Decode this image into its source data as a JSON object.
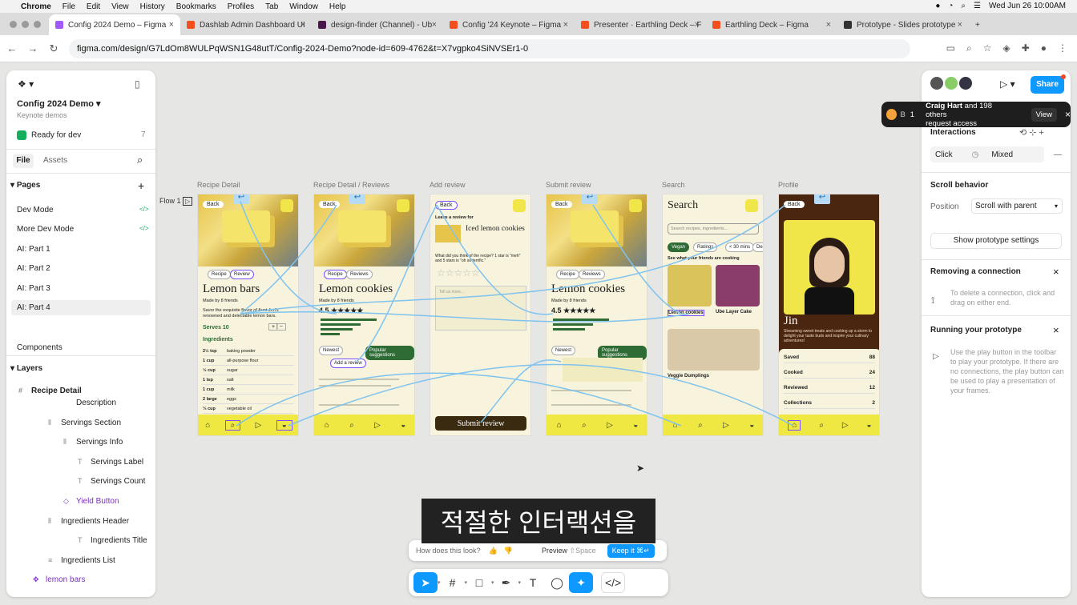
{
  "menubar": {
    "app": "Chrome",
    "items": [
      "File",
      "Edit",
      "View",
      "History",
      "Bookmarks",
      "Profiles",
      "Tab",
      "Window",
      "Help"
    ],
    "datetime": "Wed Jun 26  10:00AM"
  },
  "tabs": [
    {
      "label": "Config 2024 Demo – Figma",
      "active": true
    },
    {
      "label": "Dashlab Admin Dashboard UI",
      "active": false
    },
    {
      "label": "design-finder (Channel) - Ub",
      "active": false
    },
    {
      "label": "Config '24 Keynote – Figma",
      "active": false
    },
    {
      "label": "Presenter · Earthling Deck – F",
      "active": false
    },
    {
      "label": "Earthling Deck – Figma",
      "active": false
    },
    {
      "label": "Prototype - Slides prototype",
      "active": false
    }
  ],
  "address": {
    "url": "figma.com/design/G7LdOm8WULPqWSN1G48utT/Config-2024-Demo?node-id=609-4762&t=X7vgpko4SiNVSEr1-0"
  },
  "left_panel": {
    "file_title": "Config 2024 Demo",
    "subtitle": "Keynote demos",
    "ready_for_dev": "Ready for dev",
    "ready_count": "7",
    "tab_file": "File",
    "tab_assets": "Assets",
    "pages_label": "Pages",
    "pages": [
      {
        "label": "Dev Mode"
      },
      {
        "label": "More Dev Mode"
      },
      {
        "label": "AI: Part 1"
      },
      {
        "label": "AI: Part 2"
      },
      {
        "label": "AI: Part 3"
      },
      {
        "label": "AI: Part 4"
      }
    ],
    "components_label": "Components",
    "layers_label": "Layers",
    "layers": [
      {
        "label": "Recipe Detail"
      },
      {
        "label": "Description"
      },
      {
        "label": "Servings Section"
      },
      {
        "label": "Servings Info"
      },
      {
        "label": "Servings Label"
      },
      {
        "label": "Servings Count"
      },
      {
        "label": "Yield Button"
      },
      {
        "label": "Ingredients Header"
      },
      {
        "label": "Ingredients Title"
      },
      {
        "label": "Ingredients List"
      },
      {
        "label": "lemon bars"
      }
    ]
  },
  "right_panel": {
    "share": "Share",
    "toast_text_name": "Craig Hart",
    "toast_text_rest": " and 198 others",
    "toast_text_line2": "request access",
    "toast_view": "View",
    "toast_badge": "1",
    "interactions_label": "Interactions",
    "trigger": "Click",
    "mixed": "Mixed",
    "scroll_behavior": "Scroll behavior",
    "position_label": "Position",
    "position_value": "Scroll with parent",
    "show_settings": "Show prototype settings",
    "removing_title": "Removing a connection",
    "removing_text": "To delete a connection, click and drag on either end.",
    "running_title": "Running your prototype",
    "running_text": "Use the play button in the toolbar to play your prototype. If there are no connections, the play button can be used to play a presentation of your frames."
  },
  "canvas": {
    "flow_label": "Flow 1",
    "frames": [
      {
        "label": "Recipe Detail",
        "title": "Lemon bars"
      },
      {
        "label": "Recipe Detail / Reviews",
        "title": "Lemon cookies"
      },
      {
        "label": "Add review",
        "title": "Iced lemon cookies"
      },
      {
        "label": "Submit review",
        "title": "Lemon cookies"
      },
      {
        "label": "Search",
        "title": "Search"
      },
      {
        "label": "Profile",
        "title": "Jin"
      }
    ],
    "recipe": {
      "back": "Back",
      "tab_recipe": "Recipe",
      "tab_review": "Review",
      "tab_reviews": "Reviews",
      "made_by": "Made by 8 friends",
      "desc": "Savor the exquisite flavor of Aunt Jeri's renowned and delectable lemon bars.",
      "serves": "Serves 10",
      "ingredients_title": "Ingredients",
      "ingredients": [
        {
          "qty": "2½ tsp",
          "item": "baking powder"
        },
        {
          "qty": "1 cup",
          "item": "all-purpose flour"
        },
        {
          "qty": "½ cup",
          "item": "sugar"
        },
        {
          "qty": "1 tsp",
          "item": "salt"
        },
        {
          "qty": "1 cup",
          "item": "milk"
        },
        {
          "qty": "2 large",
          "item": "eggs"
        },
        {
          "qty": "⅓ cup",
          "item": "vegetable oil"
        }
      ]
    },
    "reviews": {
      "rating": "4.5",
      "newest": "Newest",
      "popular": "Popular suggestions",
      "add_review": "Add a review"
    },
    "add_review": {
      "leave": "Leave a review for",
      "question": "What did you think of the recipe? 1 star is \"meh\" and 5 stars is \"oh so terrific.\"",
      "placeholder": "Tell us more...",
      "submit": "Submit review"
    },
    "search": {
      "placeholder": "Search recipes, ingredients...",
      "chips": [
        "Vegan",
        "Ratings",
        "< 30 mins",
        "Des"
      ],
      "friends": "See what your friends are cooking",
      "item1": "Lemon cookies",
      "item2": "Ube Layer Cake",
      "item3": "Veggie Dumplings"
    },
    "profile": {
      "bio": "Streaming sweet treats and cooking up a storm to delight your taste buds and inspire your culinary adventures!",
      "rows": [
        {
          "label": "Saved",
          "count": "88"
        },
        {
          "label": "Cooked",
          "count": "24"
        },
        {
          "label": "Reviewed",
          "count": "12"
        },
        {
          "label": "Collections",
          "count": "2"
        }
      ]
    }
  },
  "caption": "적절한 인터랙션을",
  "ai_bar": {
    "question": "How does this look?",
    "preview": "Preview",
    "space": "Space",
    "keep": "Keep it ⌘↵"
  }
}
